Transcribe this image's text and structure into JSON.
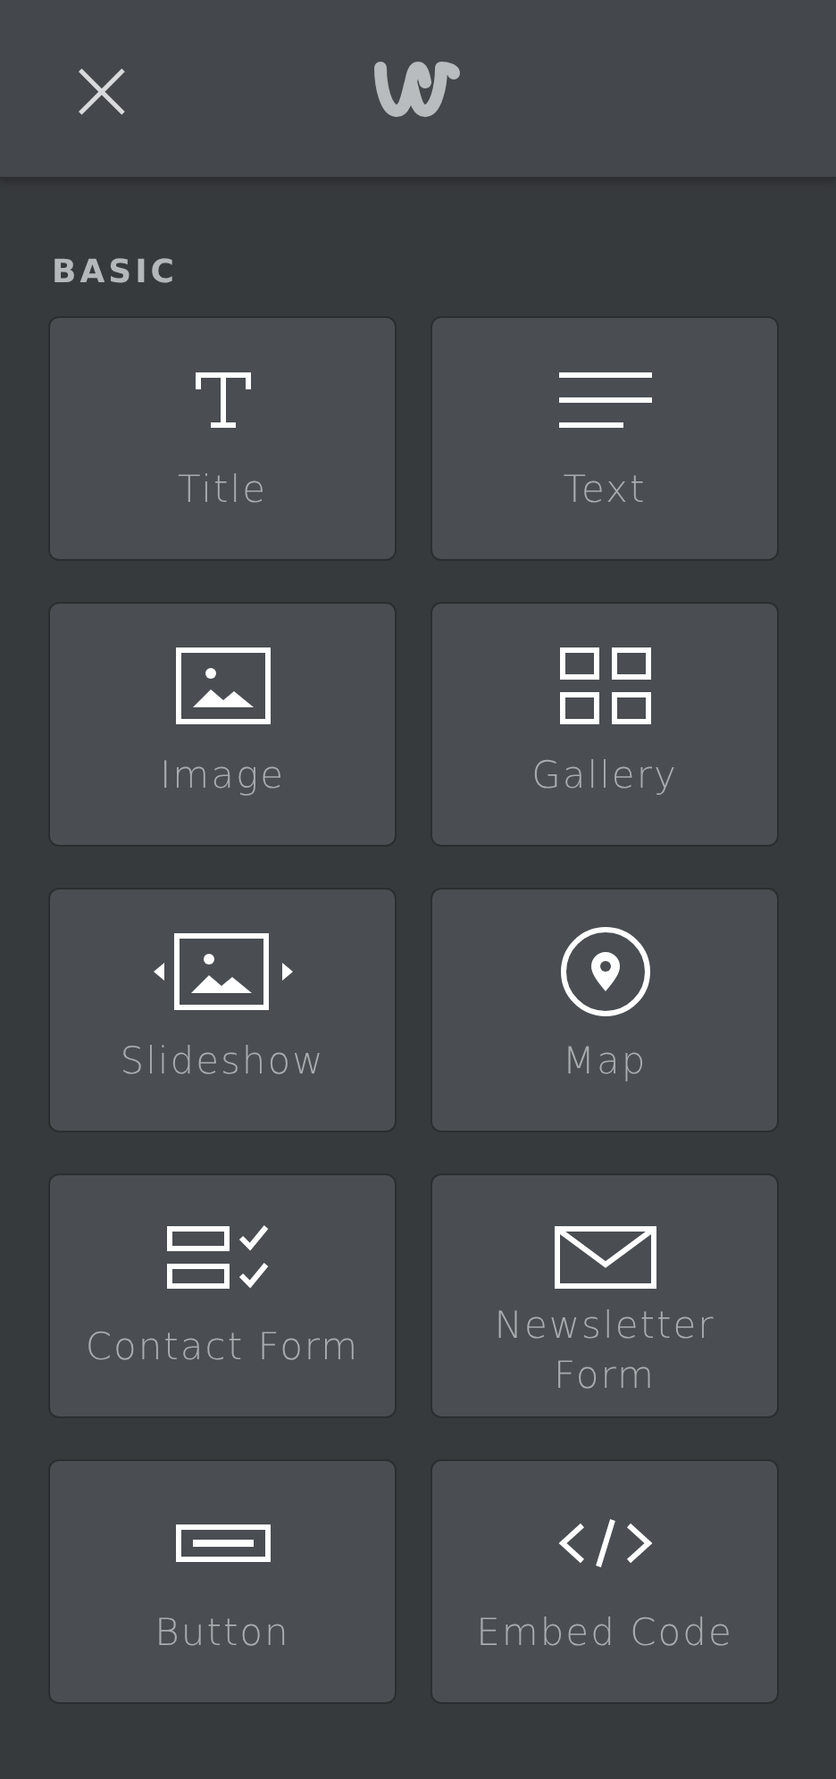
{
  "header": {
    "close": "×"
  },
  "section": {
    "title": "BASIC"
  },
  "elements": [
    {
      "label": "Title"
    },
    {
      "label": "Text"
    },
    {
      "label": "Image"
    },
    {
      "label": "Gallery"
    },
    {
      "label": "Slideshow"
    },
    {
      "label": "Map"
    },
    {
      "label": "Contact Form"
    },
    {
      "label": "Newsletter\nForm"
    },
    {
      "label": "Button"
    },
    {
      "label": "Embed Code"
    }
  ]
}
